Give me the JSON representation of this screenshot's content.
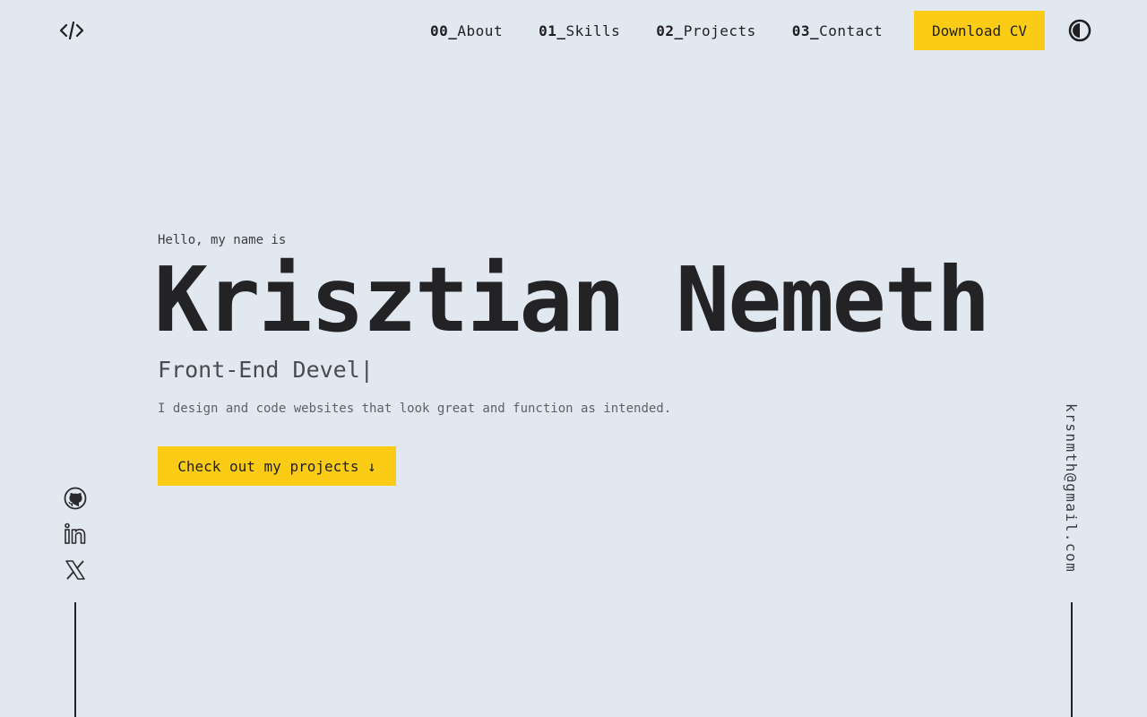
{
  "header": {
    "logo_icon": "code-brackets-icon",
    "nav": [
      {
        "num": "00_",
        "label": "About"
      },
      {
        "num": "01_",
        "label": "Skills"
      },
      {
        "num": "02_",
        "label": "Projects"
      },
      {
        "num": "03_",
        "label": "Contact"
      }
    ],
    "cv_label": "Download CV",
    "theme_icon": "contrast-toggle-icon"
  },
  "hero": {
    "greeting": "Hello, my name is",
    "name": "Krisztian Nemeth",
    "role": "Front-End Devel|",
    "description": "I design and code websites that look great and function as intended.",
    "cta_label": "Check out my projects ↓"
  },
  "socials": [
    {
      "icon": "github-icon"
    },
    {
      "icon": "linkedin-icon"
    },
    {
      "icon": "x-twitter-icon"
    }
  ],
  "email": "krsnmth@gmail.com",
  "colors": {
    "background": "#e2e8f0",
    "accent": "#facc15",
    "text": "#1f1f22"
  }
}
